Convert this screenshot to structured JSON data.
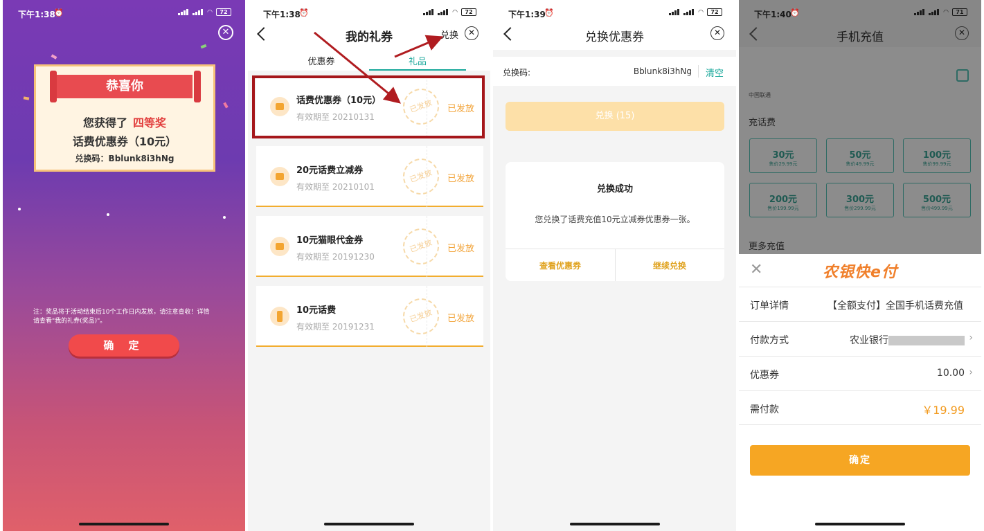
{
  "panel1": {
    "status": {
      "time": "下午1:38",
      "battery": "72"
    },
    "card_title": "恭喜你",
    "won_prefix": "您获得了",
    "prize_level": "四等奖",
    "prize_name": "话费优惠券（10元）",
    "code_line": "兑换码：Bblunk8i3hNg",
    "note": "注：奖品将于活动结束后10个工作日内发放，请注意查收！详情请查看\"我的礼券(奖品)\"。",
    "confirm_label": "确 定"
  },
  "panel2": {
    "status": {
      "time": "下午1:38",
      "battery": "72"
    },
    "title": "我的礼券",
    "exchange_link": "兑换",
    "tabs": [
      "优惠券",
      "礼品"
    ],
    "items": [
      {
        "name": "话费优惠券（10元）",
        "expiry": "有效期至 20210131",
        "stamp": "已发放",
        "status": "已发放"
      },
      {
        "name": "20元话费立减券",
        "expiry": "有效期至 20210101",
        "stamp": "已发放",
        "status": "已发放"
      },
      {
        "name": "10元猫眼代金券",
        "expiry": "有效期至 20191230",
        "stamp": "已发放",
        "status": "已发放"
      },
      {
        "name": "10元话费",
        "expiry": "有效期至 20191231",
        "stamp": "已发放",
        "status": "已发放"
      }
    ]
  },
  "panel3": {
    "status": {
      "time": "下午1:39",
      "battery": "72"
    },
    "title": "兑换优惠券",
    "code_label": "兑换码:",
    "code_value": "Bblunk8i3hNg",
    "clear_label": "清空",
    "exchange_button": "兑换 (15)",
    "dialog": {
      "title": "兑换成功",
      "message": "您兑换了话费充值10元立减券优惠券一张。",
      "view_button": "查看优惠券",
      "continue_button": "继续兑换"
    }
  },
  "panel4": {
    "status": {
      "time": "下午1:40",
      "battery": "71"
    },
    "title": "手机充值",
    "carrier": "中国联通",
    "section_recharge": "充话费",
    "amounts": [
      {
        "amount": "30元",
        "price": "售价29.99元"
      },
      {
        "amount": "50元",
        "price": "售价49.99元"
      },
      {
        "amount": "100元",
        "price": "售价99.99元"
      },
      {
        "amount": "200元",
        "price": "售价199.99元"
      },
      {
        "amount": "300元",
        "price": "售价299.99元"
      },
      {
        "amount": "500元",
        "price": "售价499.99元"
      }
    ],
    "section_more": "更多充值",
    "sheet": {
      "brand": "农银快e付",
      "order_label": "订单详情",
      "order_value": "【全额支付】全国手机话费充值",
      "pay_label": "付款方式",
      "pay_value": "农业银行",
      "coupon_label": "优惠券",
      "coupon_value": "10.00",
      "due_label": "需付款",
      "due_value": "￥19.99",
      "confirm_label": "确定"
    }
  }
}
